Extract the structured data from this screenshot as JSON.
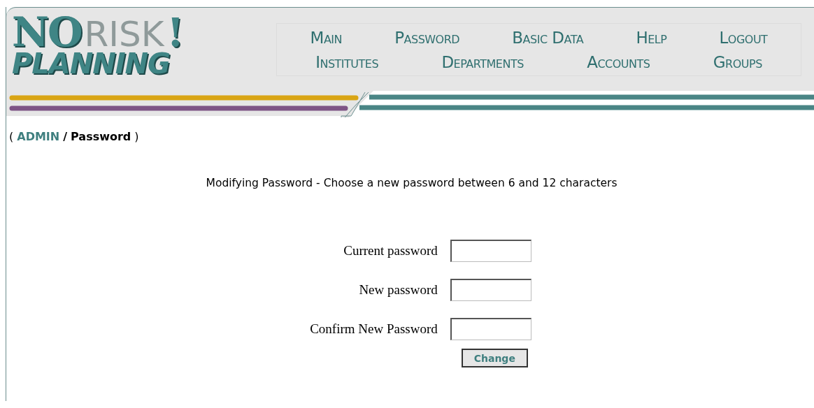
{
  "logo": {
    "first": "NO",
    "second": "RISK",
    "mark": "!",
    "tagline": "PLANNING"
  },
  "nav": [
    [
      {
        "label": "Main"
      },
      {
        "label": "Password"
      },
      {
        "label": "Basic Data"
      },
      {
        "label": "Help"
      },
      {
        "label": "Logout"
      }
    ],
    [
      {
        "label": "Institutes"
      },
      {
        "label": "Departments"
      },
      {
        "label": "Accounts"
      },
      {
        "label": "Groups"
      }
    ]
  ],
  "breadcrumb": {
    "open": "(",
    "link": "ADMIN",
    "separator": "/",
    "current": "Password",
    "close": ")"
  },
  "heading": "Modifying Password - Choose a new password between 6 and 12 characters",
  "fields": [
    {
      "label": "Current password"
    },
    {
      "label": "New password"
    },
    {
      "label": "Confirm New Password"
    }
  ],
  "button": "Change"
}
